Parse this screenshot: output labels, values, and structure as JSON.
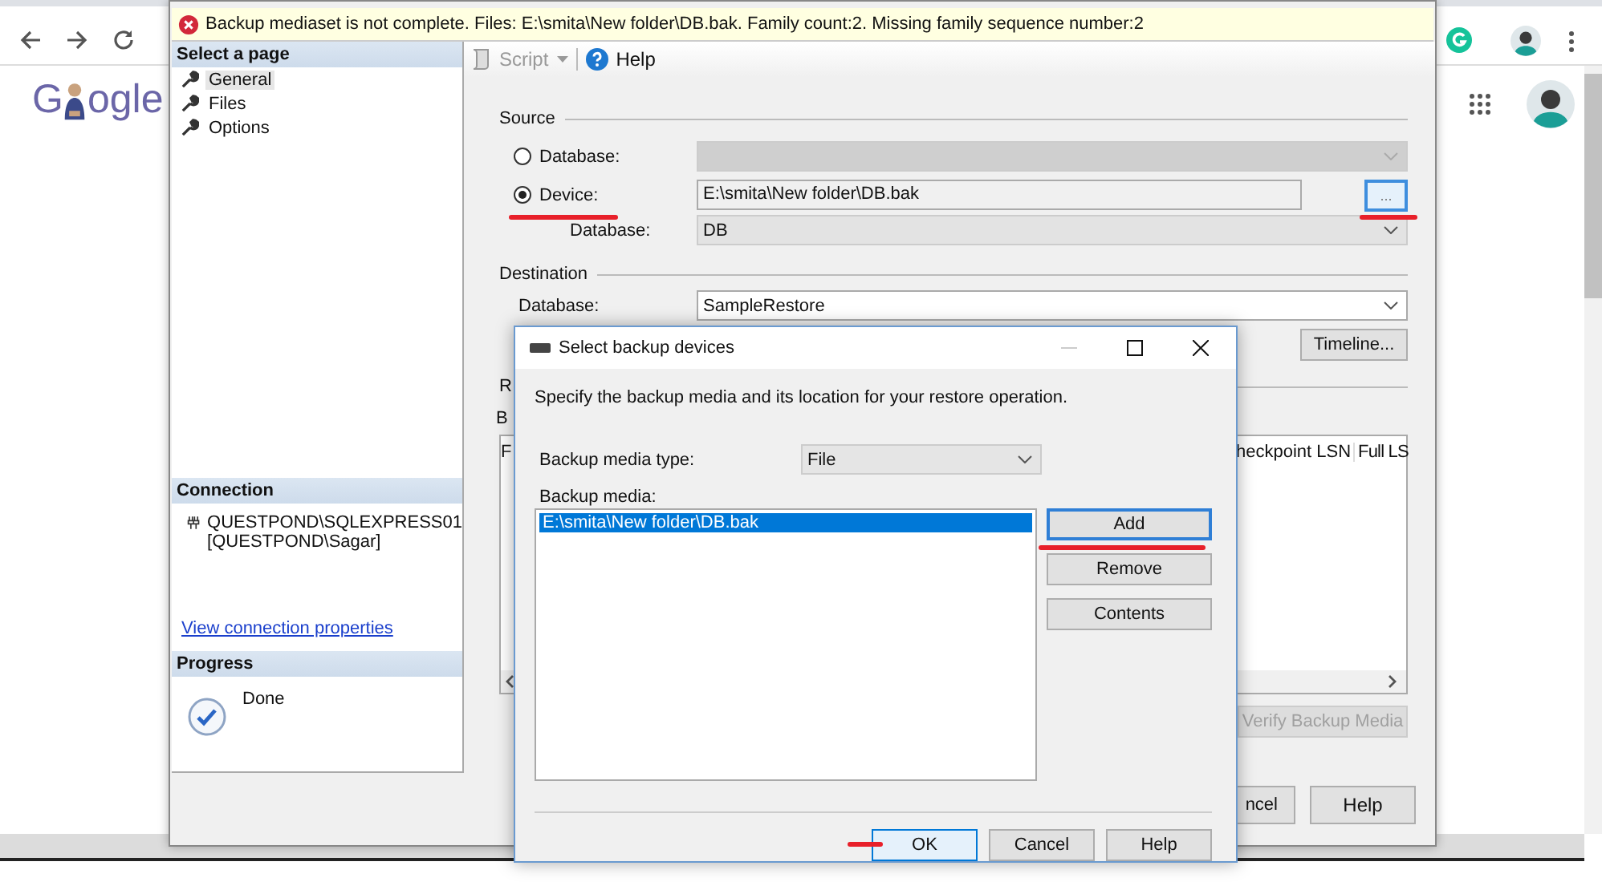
{
  "browser": {
    "logo_parts": [
      "G",
      "ogle"
    ]
  },
  "restore_window": {
    "error_message": "Backup mediaset is not complete. Files: E:\\smita\\New folder\\DB.bak. Family count:2. Missing family sequence number:2",
    "sidebar": {
      "header": "Select a page",
      "items": [
        {
          "label": "General",
          "selected": true
        },
        {
          "label": "Files",
          "selected": false
        },
        {
          "label": "Options",
          "selected": false
        }
      ]
    },
    "connection": {
      "header": "Connection",
      "server": "QUESTPOND\\SQLEXPRESS01",
      "user": "[QUESTPOND\\Sagar]",
      "link": "View connection properties"
    },
    "progress": {
      "header": "Progress",
      "status": "Done"
    },
    "toolbar": {
      "script": "Script",
      "help": "Help"
    },
    "source": {
      "title": "Source",
      "options": [
        {
          "label": "Database:",
          "selected": false
        },
        {
          "label": "Device:",
          "selected": true,
          "underlined": true
        }
      ],
      "device_path": "E:\\smita\\New folder\\DB.bak",
      "browse": "...",
      "browse_underlined": true,
      "database_label": "Database:",
      "database_value": "DB"
    },
    "destination": {
      "title": "Destination",
      "database_label": "Database:",
      "database_value": "SampleRestore",
      "timeline": "Timeline..."
    },
    "restore_plan": {
      "title": "R",
      "label": "B",
      "columns": [
        "F",
        "heckpoint LSN",
        "Full LS"
      ],
      "verify": "Verify Backup Media",
      "verify_disabled": true
    },
    "buttons": [
      "ncel",
      "Help"
    ]
  },
  "dialog": {
    "title": "Select backup devices",
    "description": "Specify the backup media and its location for your restore operation.",
    "media_type_label": "Backup media type:",
    "media_type": "File",
    "media_label": "Backup media:",
    "media": [
      {
        "path": "E:\\smita\\New folder\\DB.bak",
        "selected": true
      }
    ],
    "side_buttons": [
      {
        "label": "Add",
        "focused": true,
        "underlined": true
      },
      {
        "label": "Remove",
        "focused": false,
        "underlined": false
      },
      {
        "label": "Contents",
        "focused": false,
        "underlined": false
      }
    ],
    "buttons": [
      {
        "label": "OK",
        "default": true,
        "marked": true
      },
      {
        "label": "Cancel",
        "default": false,
        "marked": false
      },
      {
        "label": "Help",
        "default": false,
        "marked": false
      }
    ]
  }
}
